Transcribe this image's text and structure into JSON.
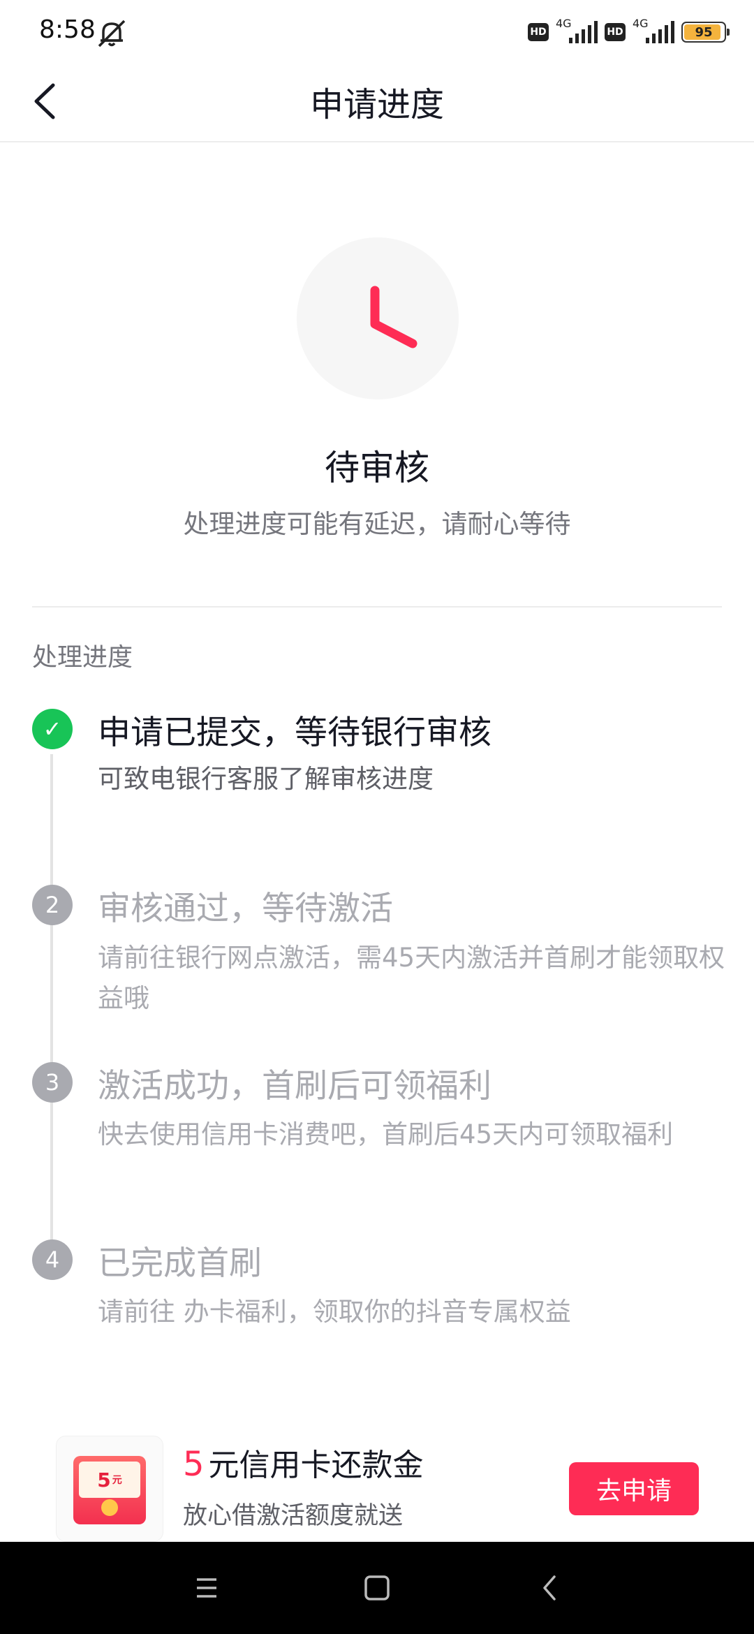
{
  "status_bar": {
    "time": "8:58",
    "hd_label": "HD",
    "network_1": "4G",
    "network_2": "4G",
    "battery": "95"
  },
  "header": {
    "title": "申请进度"
  },
  "status": {
    "icon": "clock-icon",
    "title": "待审核",
    "subtitle": "处理进度可能有延迟，请耐心等待"
  },
  "progress": {
    "section_label": "处理进度",
    "steps": [
      {
        "marker": "✓",
        "title": "申请已提交，等待银行审核",
        "desc": "可致电银行客服了解审核进度",
        "state": "done"
      },
      {
        "marker": "2",
        "title": "审核通过，等待激活",
        "desc": "请前往银行网点激活，需45天内激活并首刷才能领取权益哦",
        "state": "pending"
      },
      {
        "marker": "3",
        "title": "激活成功，首刷后可领福利",
        "desc": "快去使用信用卡消费吧，首刷后45天内可领取福利",
        "state": "pending"
      },
      {
        "marker": "4",
        "title": "已完成首刷",
        "desc": "请前往 办卡福利，领取你的抖音专属权益",
        "state": "pending"
      }
    ]
  },
  "promo": {
    "thumb_amount": "5",
    "thumb_unit": "元",
    "amount": "5",
    "title": "元信用卡还款金",
    "subtitle": "放心借激活额度就送",
    "button_label": "去申请"
  },
  "colors": {
    "accent": "#fe2c55",
    "done": "#18c457",
    "pending": "#a9aab0"
  }
}
